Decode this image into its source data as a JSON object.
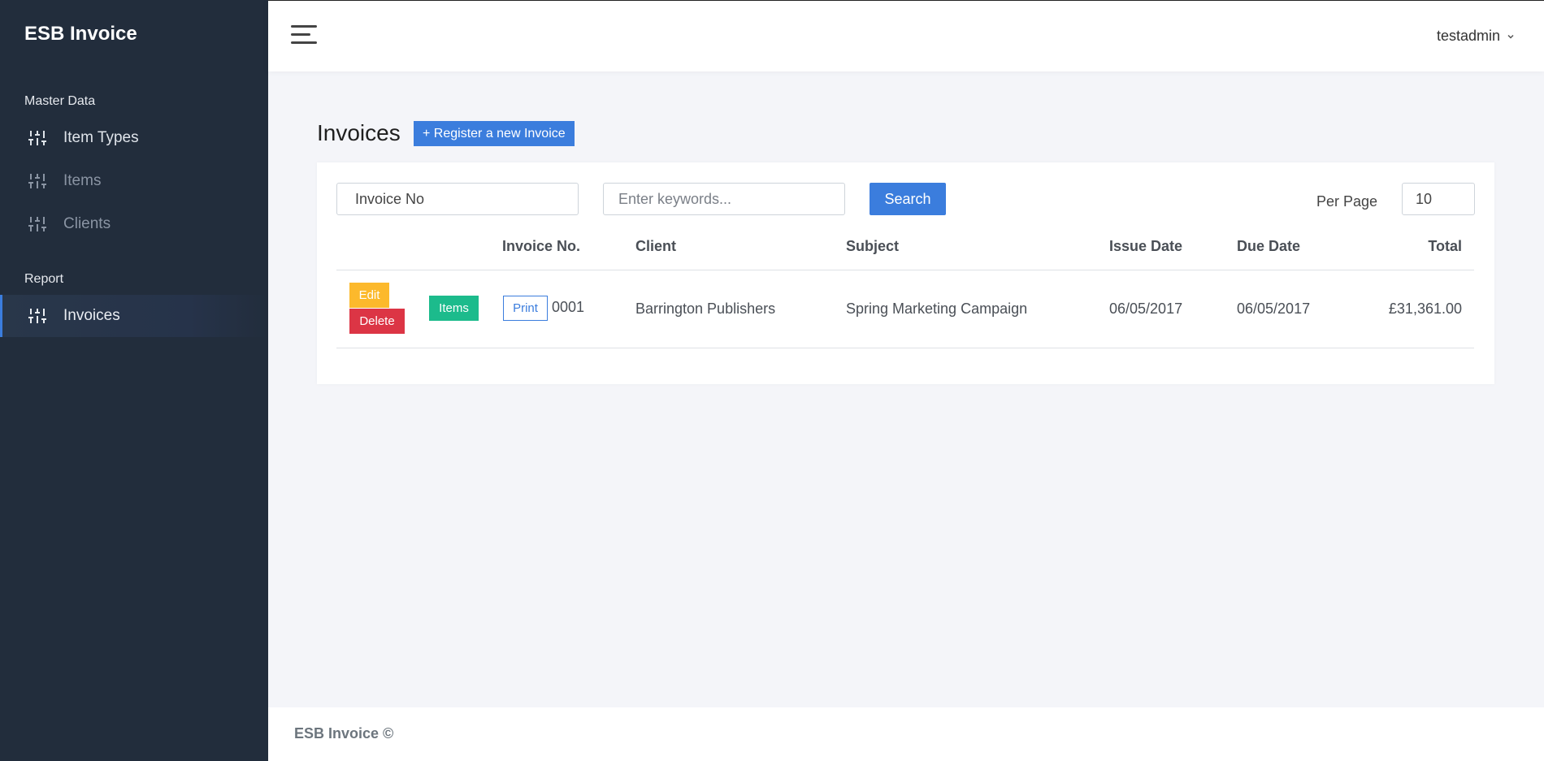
{
  "app": {
    "brand": "ESB Invoice"
  },
  "sidebar": {
    "sections": [
      {
        "label": "Master Data"
      },
      {
        "label": "Report"
      }
    ],
    "items": [
      {
        "label": "Item Types",
        "icon": "sliders-icon"
      },
      {
        "label": "Items",
        "icon": "sliders-icon"
      },
      {
        "label": "Clients",
        "icon": "sliders-icon"
      },
      {
        "label": "Invoices",
        "icon": "sliders-icon"
      }
    ]
  },
  "topbar": {
    "user": "testadmin"
  },
  "page": {
    "title": "Invoices",
    "register_label": "+ Register a new Invoice"
  },
  "filters": {
    "invoice_no_value": "Invoice No",
    "keywords_placeholder": "Enter keywords...",
    "search_label": "Search",
    "per_page_label": "Per Page",
    "per_page_value": "10"
  },
  "table": {
    "headers": [
      "Invoice No.",
      "Client",
      "Subject",
      "Issue Date",
      "Due Date",
      "Total"
    ],
    "rows": [
      {
        "edit_label": "Edit",
        "delete_label": "Delete",
        "items_label": "Items",
        "print_label": "Print",
        "invoice_no": "0001",
        "client": "Barrington Publishers",
        "subject": "Spring Marketing Campaign",
        "issue_date": "06/05/2017",
        "due_date": "06/05/2017",
        "total": "£31,361.00"
      }
    ]
  },
  "footer": {
    "text": "ESB Invoice ©"
  },
  "colors": {
    "sidebar_bg": "#222d3c",
    "primary": "#3b7ddd",
    "warning": "#fcb92c",
    "danger": "#dc3545",
    "success": "#1cbb8c"
  }
}
